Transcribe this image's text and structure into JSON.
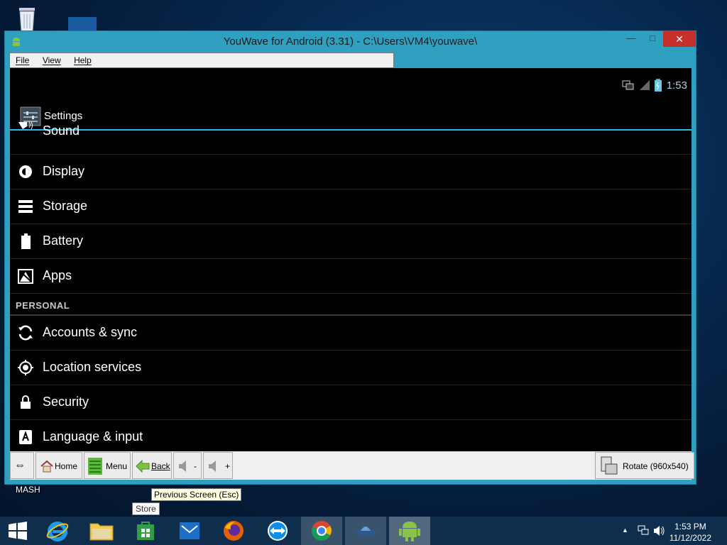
{
  "window": {
    "title": "YouWave for Android (3.31) - C:\\Users\\VM4\\youwave\\",
    "menu": [
      "File",
      "View",
      "Help"
    ]
  },
  "android": {
    "time": "1:53",
    "action_title": "Settings",
    "items": [
      {
        "label": "Sound",
        "icon": "speaker-icon"
      },
      {
        "label": "Display",
        "icon": "brightness-icon"
      },
      {
        "label": "Storage",
        "icon": "storage-icon"
      },
      {
        "label": "Battery",
        "icon": "battery-icon"
      },
      {
        "label": "Apps",
        "icon": "apps-icon"
      }
    ],
    "section": "PERSONAL",
    "personal_items": [
      {
        "label": "Accounts & sync",
        "icon": "sync-icon"
      },
      {
        "label": "Location services",
        "icon": "location-icon"
      },
      {
        "label": "Security",
        "icon": "lock-icon"
      },
      {
        "label": "Language & input",
        "icon": "language-icon"
      }
    ]
  },
  "toolbar": {
    "resize": "⇔",
    "home": "Home",
    "menu": "Menu",
    "back": "Back",
    "vol_down": "-",
    "vol_up": "+",
    "rotate": "Rotate (960x540)"
  },
  "tooltip": "Previous Screen (Esc)",
  "desktop": {
    "label": "MASH",
    "store_tip": "Store"
  },
  "taskbar": {
    "time": "1:53 PM",
    "date": "11/12/2022"
  },
  "colors": {
    "accent": "#33b5e5",
    "titlebar": "#2fa0c0",
    "close": "#c7302a"
  }
}
